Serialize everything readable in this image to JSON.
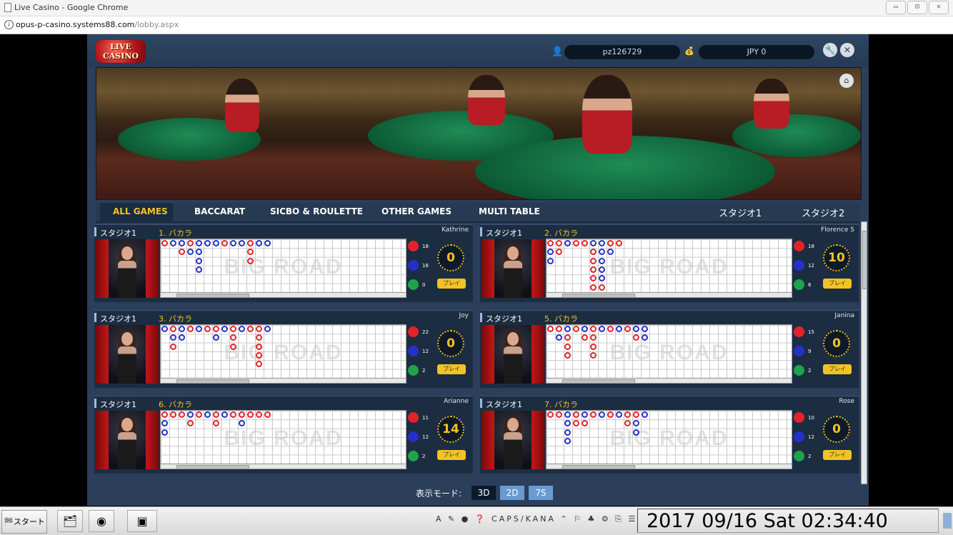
{
  "browser": {
    "window_title": "Live Casino - Google Chrome",
    "url_host": "opus-p-casino.systems88.com",
    "url_path": "/lobby.aspx",
    "window_buttons": [
      "▭",
      "⊡",
      "✕"
    ]
  },
  "header": {
    "logo_line1": "LIVE",
    "logo_line2": "CASINO",
    "username": "pz126729",
    "balance": "JPY 0",
    "settings_icon": "wrench-icon",
    "close_icon": "close-icon"
  },
  "nav": {
    "tabs": [
      "ALL GAMES",
      "BACCARAT",
      "SICBO & ROULETTE",
      "OTHER GAMES",
      "MULTI TABLE"
    ],
    "active_tab": "ALL GAMES",
    "studios": [
      "スタジオ1",
      "スタジオ2"
    ]
  },
  "tables": [
    {
      "studio": "スタジオ1",
      "game": "1. バカラ",
      "dealer": "Kathrine",
      "red": "18",
      "blue": "16",
      "green": "0",
      "timer": "0",
      "play": "プレイ"
    },
    {
      "studio": "スタジオ1",
      "game": "2. バカラ",
      "dealer": "Florence S",
      "red": "18",
      "blue": "12",
      "green": "6",
      "timer": "10",
      "play": "プレイ"
    },
    {
      "studio": "スタジオ1",
      "game": "3. バカラ",
      "dealer": "Joy",
      "red": "22",
      "blue": "12",
      "green": "2",
      "timer": "0",
      "play": "プレイ"
    },
    {
      "studio": "スタジオ1",
      "game": "5. バカラ",
      "dealer": "Janina",
      "red": "15",
      "blue": "9",
      "green": "2",
      "timer": "0",
      "play": "プレイ"
    },
    {
      "studio": "スタジオ1",
      "game": "6. バカラ",
      "dealer": "Arianne",
      "red": "11",
      "blue": "12",
      "green": "2",
      "timer": "14",
      "play": "プレイ"
    },
    {
      "studio": "スタジオ1",
      "game": "7. バカラ",
      "dealer": "Rose",
      "red": "10",
      "blue": "12",
      "green": "2",
      "timer": "0",
      "play": "プレイ"
    }
  ],
  "road_label": "BIG ROAD",
  "display_mode": {
    "label": "表示モード:",
    "options": [
      "3D",
      "2D",
      "7S"
    ],
    "selected": "3D"
  },
  "taskbar": {
    "start": "スタート",
    "clock": "2017 09/16  Sat  02:34:40",
    "tray_caps": "CAPS",
    "tray_kana": "KANA"
  },
  "colors": {
    "accent": "#f3c323",
    "banker": "#e2232a",
    "player": "#2431c8",
    "tie": "#1fa34a"
  }
}
